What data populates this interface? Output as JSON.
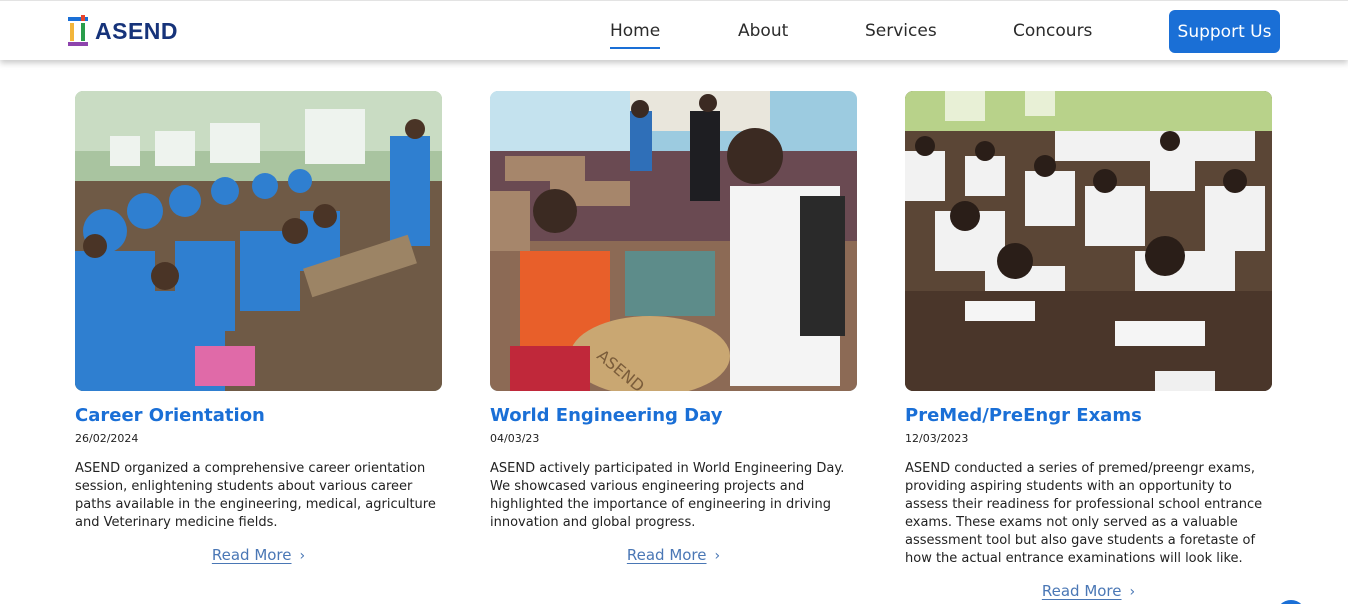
{
  "brand": {
    "name": "ASEND",
    "logo_icon": "asend-logo-icon"
  },
  "nav": {
    "items": [
      {
        "label": "Home",
        "active": true
      },
      {
        "label": "About",
        "active": false
      },
      {
        "label": "Services",
        "active": false
      },
      {
        "label": "Concours",
        "active": false
      }
    ],
    "cta_label": "Support Us"
  },
  "colors": {
    "accent": "#1a6fd6",
    "brand_text": "#16337a",
    "link": "#4a77b5"
  },
  "cards": [
    {
      "title": "Career Orientation",
      "date": "26/02/2024",
      "description": "ASEND organized a comprehensive career orientation session, enlightening students about various career paths available in the engineering, medical, agriculture and Veterinary medicine fields.",
      "link_label": "Read More",
      "image": "classroom-students-photo"
    },
    {
      "title": "World Engineering Day",
      "date": "04/03/23",
      "description": "ASEND actively participated in World Engineering Day. We showcased various engineering projects and highlighted the importance of engineering in driving innovation and global progress.",
      "link_label": "Read More",
      "image": "engineering-project-photo"
    },
    {
      "title": "PreMed/PreEngr Exams",
      "date": "12/03/2023",
      "description": "ASEND conducted a series of premed/preengr exams, providing aspiring students with an opportunity to assess their readiness for professional school entrance exams. These exams not only served as a valuable assessment tool but also gave students a foretaste of how the actual entrance examinations will look like.",
      "link_label": "Read More",
      "image": "exam-hall-photo"
    }
  ]
}
